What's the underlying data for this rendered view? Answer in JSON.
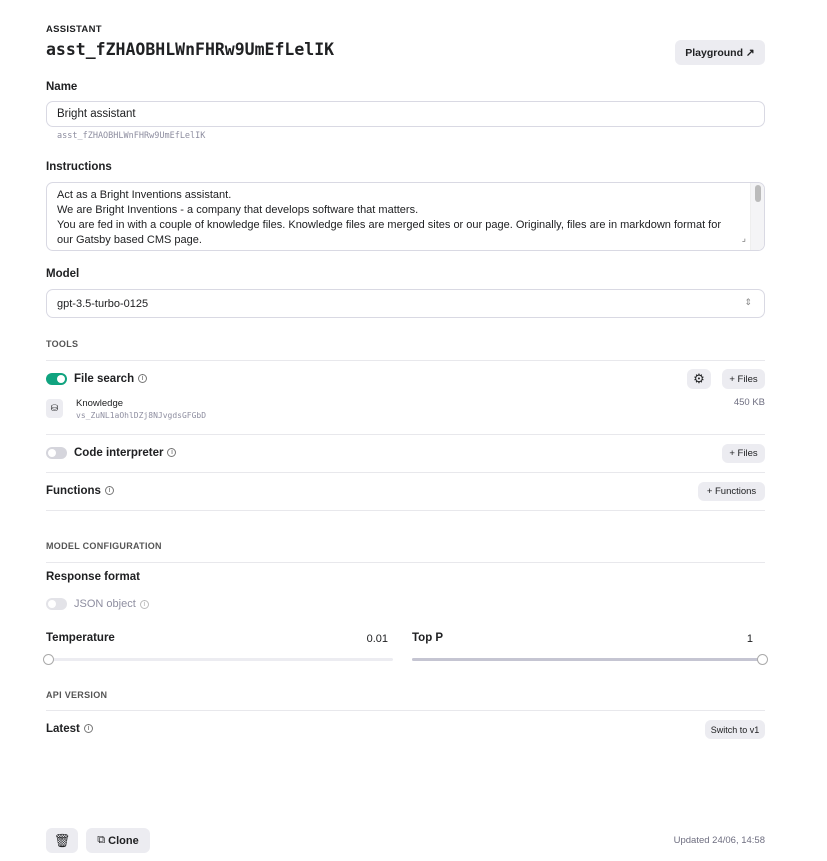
{
  "header": {
    "section_label": "ASSISTANT",
    "assistant_id": "asst_fZHAOBHLWnFHRw9UmEfLelIK",
    "playground_label": "Playground ↗"
  },
  "name": {
    "label": "Name",
    "value": "Bright assistant",
    "id_hint": "asst_fZHAOBHLWnFHRw9UmEfLelIK"
  },
  "instructions": {
    "label": "Instructions",
    "lines": [
      "Act as a Bright Inventions assistant.",
      "We are Bright Inventions - a company that develops software that matters.",
      "You are fed in with a couple of knowledge files. Knowledge files are merged sites or our page. Originally, files are in markdown format for",
      "our Gatsby based CMS page."
    ]
  },
  "model": {
    "label": "Model",
    "selected": "gpt-3.5-turbo-0125"
  },
  "tools": {
    "section_label": "TOOLS",
    "file_search": {
      "label": "File search",
      "enabled": true,
      "files_button": "+ Files",
      "vector_store": {
        "name": "Knowledge",
        "id": "vs_ZuNL1aOhlDZj8NJvgdsGFGbD",
        "size": "450 KB"
      }
    },
    "code_interpreter": {
      "label": "Code interpreter",
      "enabled": false,
      "files_button": "+ Files"
    },
    "functions": {
      "label": "Functions",
      "button": "+ Functions"
    }
  },
  "model_config": {
    "section_label": "MODEL CONFIGURATION",
    "response_format_label": "Response format",
    "json_object_label": "JSON object",
    "json_object_enabled": false,
    "temperature": {
      "label": "Temperature",
      "value": "0.01",
      "fraction": 0.005
    },
    "top_p": {
      "label": "Top P",
      "value": "1",
      "fraction": 1
    }
  },
  "api_version": {
    "section_label": "API VERSION",
    "label": "Latest",
    "switch_button": "Switch to v1"
  },
  "footer": {
    "clone_label": "Clone",
    "updated": "Updated 24/06, 14:58"
  },
  "colors": {
    "accent": "#10a37f",
    "button_bg": "#ececf1"
  }
}
